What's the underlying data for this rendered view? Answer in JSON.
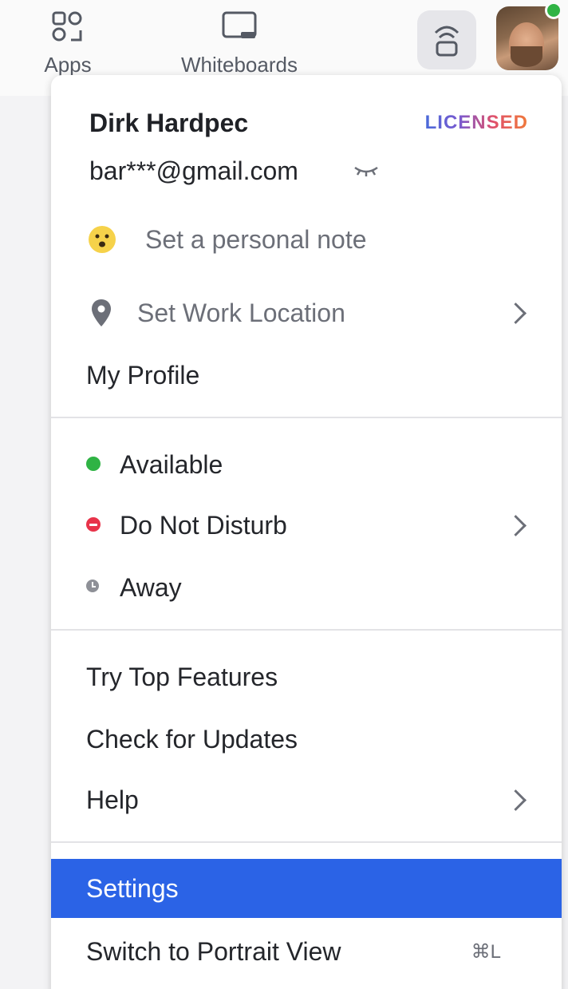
{
  "topbar": {
    "apps_label": "Apps",
    "whiteboards_label": "Whiteboards",
    "remote_icon": "remote-control-icon",
    "presence_color": "#2fb344"
  },
  "profile": {
    "name": "Dirk Hardpec",
    "license_badge": "LICENSED",
    "email": "bar***@gmail.com",
    "email_toggle_icon": "eye-closed-icon"
  },
  "menu": {
    "personal_note": "Set a personal note",
    "work_location": "Set Work Location",
    "my_profile": "My Profile",
    "status_available": "Available",
    "status_dnd": "Do Not Disturb",
    "status_away": "Away",
    "try_top_features": "Try Top Features",
    "check_updates": "Check for Updates",
    "help": "Help",
    "settings": "Settings",
    "portrait_view": "Switch to Portrait View",
    "portrait_shortcut": "⌘L"
  },
  "colors": {
    "selected_bg": "#2b63e6",
    "available": "#2fb344",
    "dnd": "#e8334a",
    "away": "#8e9097"
  }
}
